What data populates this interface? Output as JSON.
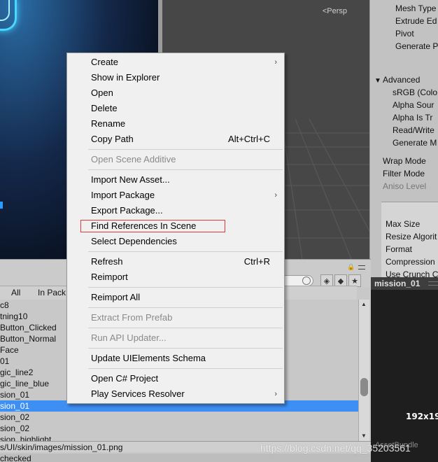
{
  "scene": {
    "persp_label": "<Persp"
  },
  "inspector": {
    "rows": [
      "Mesh Type",
      "Extrude Ed",
      "Pivot",
      "Generate P"
    ],
    "advanced_label": "Advanced",
    "advanced_rows": [
      "sRGB (Colo",
      "Alpha Sour",
      "Alpha Is Tr",
      "Read/Write",
      "Generate M"
    ],
    "wrap_mode": "Wrap Mode",
    "filter_mode": "Filter Mode",
    "aniso_level": "Aniso Level",
    "platform_rows": [
      "Max Size",
      "Resize Algorit",
      "Format",
      "Compression",
      "Use Crunch C"
    ]
  },
  "preview": {
    "title": "mission_01",
    "size": "192x19",
    "assetbundle": "AssetBundle"
  },
  "project": {
    "filter_all": "All",
    "filter_in_package": "In Pack",
    "assets": [
      "c8",
      "tning10",
      "Button_Clicked",
      "Button_Normal",
      "Face",
      "01",
      "gic_line2",
      "gic_line_blue",
      "sion_01",
      "sion_01",
      "sion_02",
      "sion_02",
      "sion_highlight"
    ],
    "selected_index": 9,
    "path": "s/UI/skin/images/mission_01.png",
    "status": "checked"
  },
  "context_menu": {
    "items": [
      {
        "label": "Create",
        "submenu": true
      },
      {
        "label": "Show in Explorer"
      },
      {
        "label": "Open"
      },
      {
        "label": "Delete"
      },
      {
        "label": "Rename"
      },
      {
        "label": "Copy Path",
        "shortcut": "Alt+Ctrl+C"
      },
      {
        "label": "Open Scene Additive",
        "disabled": true
      },
      {
        "label": "Import New Asset..."
      },
      {
        "label": "Import Package",
        "submenu": true
      },
      {
        "label": "Export Package..."
      },
      {
        "label": "Find References In Scene",
        "highlighted": true
      },
      {
        "label": "Select Dependencies"
      },
      {
        "label": "Refresh",
        "shortcut": "Ctrl+R"
      },
      {
        "label": "Reimport"
      },
      {
        "label": "Reimport All"
      },
      {
        "label": "Extract From Prefab",
        "disabled": true
      },
      {
        "label": "Run API Updater...",
        "disabled": true
      },
      {
        "label": "Update UIElements Schema"
      },
      {
        "label": "Open C# Project"
      },
      {
        "label": "Play Services Resolver",
        "submenu": true
      }
    ],
    "highlight_color": "#e23a3a"
  },
  "watermark": "https://blog.csdn.net/qq_35203561",
  "colors": {
    "selection": "#3d8ff4",
    "scene_bg": "#474747",
    "menu_bg": "#f0f0f0"
  }
}
